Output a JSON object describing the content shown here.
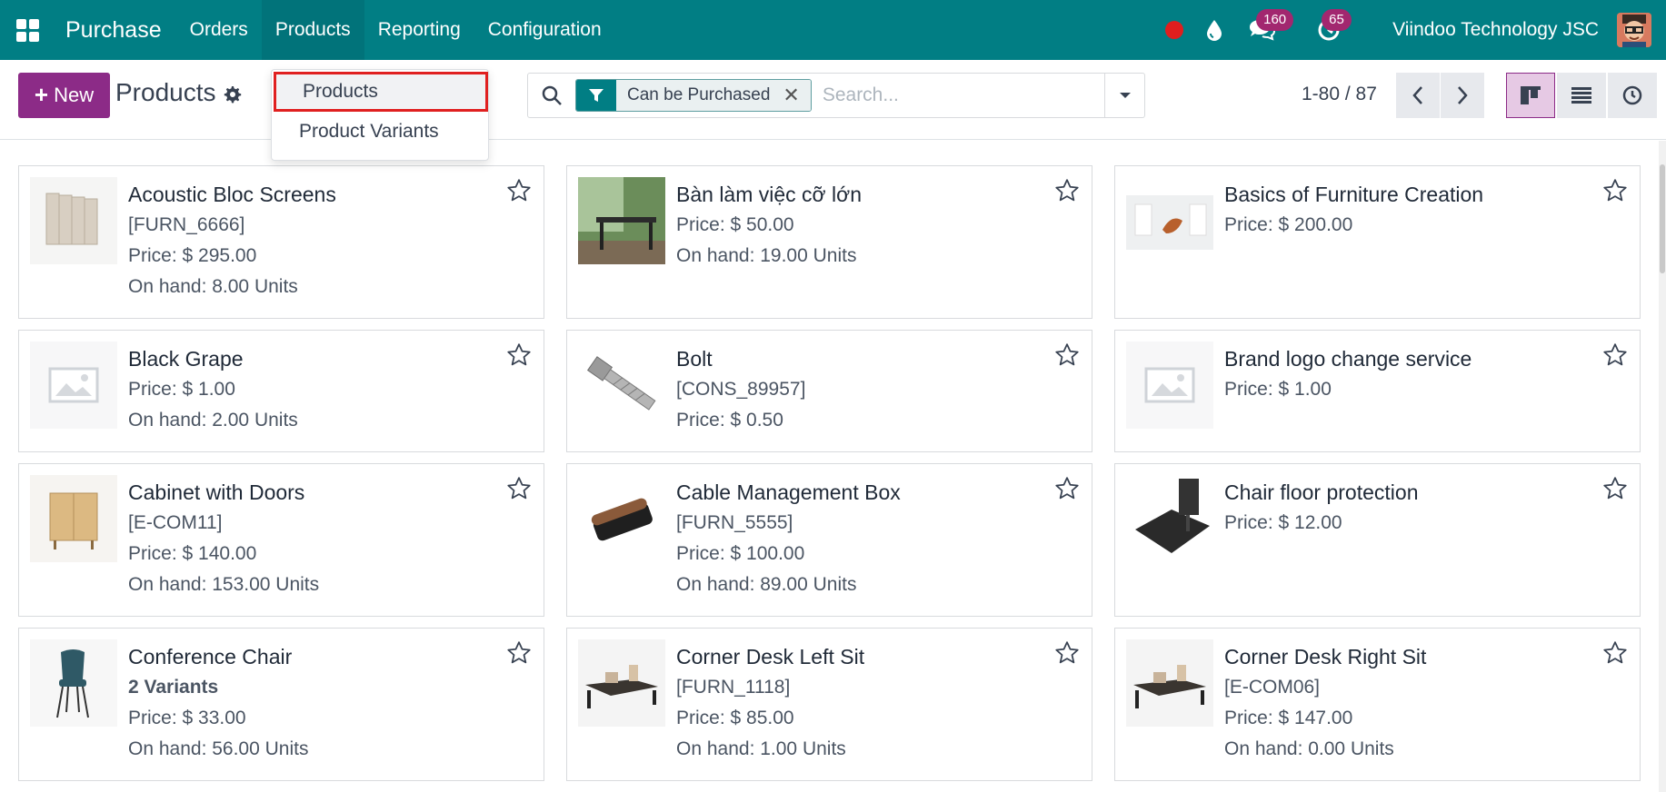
{
  "navbar": {
    "app_name": "Purchase",
    "menu": [
      "Orders",
      "Products",
      "Reporting",
      "Configuration"
    ],
    "active_menu": "Products",
    "messages_count": "160",
    "activities_count": "65",
    "company": "Viindoo Technology JSC",
    "bar_color": "#017e84"
  },
  "control": {
    "new_label": "New",
    "title": "Products",
    "filter_facet": "Can be Purchased",
    "search_placeholder": "Search...",
    "pager": "1-80 / 87",
    "accent_color": "#8c2b87"
  },
  "dropdown": {
    "items": [
      "Products",
      "Product Variants"
    ],
    "highlighted": "Products"
  },
  "products": [
    {
      "name": "Acoustic Bloc Screens",
      "lines": [
        "[FURN_6666]",
        "Price: $ 295.00",
        "On hand: 8.00 Units"
      ],
      "image": "acoustic-screen"
    },
    {
      "name": "Bàn làm việc cỡ lớn",
      "lines": [
        "Price: $ 50.00",
        "On hand: 19.00 Units"
      ],
      "image": "desk-photo"
    },
    {
      "name": "Basics of Furniture Creation",
      "lines": [
        "Price: $ 200.00"
      ],
      "image": "furniture-room"
    },
    {
      "name": "Black Grape",
      "lines": [
        "Price: $ 1.00",
        "On hand: 2.00 Units"
      ],
      "image": "placeholder"
    },
    {
      "name": "Bolt",
      "lines": [
        "[CONS_89957]",
        "Price: $ 0.50"
      ],
      "image": "bolt"
    },
    {
      "name": "Brand logo change service",
      "lines": [
        "Price: $ 1.00"
      ],
      "image": "placeholder"
    },
    {
      "name": "Cabinet with Doors",
      "lines": [
        "[E-COM11]",
        "Price: $ 140.00",
        "On hand: 153.00 Units"
      ],
      "image": "cabinet"
    },
    {
      "name": "Cable Management Box",
      "lines": [
        "[FURN_5555]",
        "Price: $ 100.00",
        "On hand: 89.00 Units"
      ],
      "image": "cable-box"
    },
    {
      "name": "Chair floor protection",
      "lines": [
        "Price: $ 12.00"
      ],
      "image": "floor-mat"
    },
    {
      "name": "Conference Chair",
      "lines": [
        "2 Variants",
        "Price: $ 33.00",
        "On hand: 56.00 Units"
      ],
      "bold_first": true,
      "image": "chair"
    },
    {
      "name": "Corner Desk Left Sit",
      "lines": [
        "[FURN_1118]",
        "Price: $ 85.00",
        "On hand: 1.00 Units"
      ],
      "image": "corner-desk"
    },
    {
      "name": "Corner Desk Right Sit",
      "lines": [
        "[E-COM06]",
        "Price: $ 147.00",
        "On hand: 0.00 Units"
      ],
      "image": "corner-desk"
    }
  ]
}
